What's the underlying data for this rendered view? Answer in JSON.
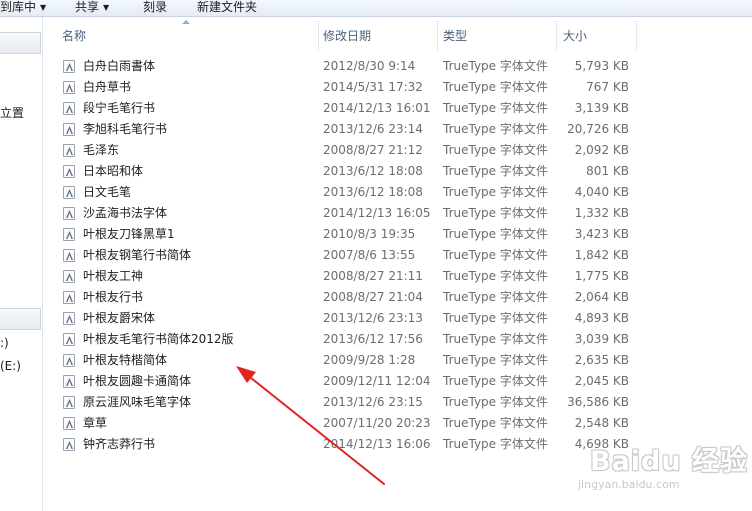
{
  "toolbar": {
    "library_label": "到库中",
    "share_label": "共享",
    "burn_label": "刻录",
    "new_folder_label": "新建文件夹"
  },
  "nav": {
    "location_fragment": "立置",
    "drive_c_fragment": ":)",
    "drive_e_fragment": "(E:)"
  },
  "columns": {
    "name": "名称",
    "date": "修改日期",
    "type": "类型",
    "size": "大小"
  },
  "files": [
    {
      "name": "白舟白雨書体",
      "date": "2012/8/30 9:14",
      "type": "TrueType 字体文件",
      "size": "5,793 KB"
    },
    {
      "name": "白舟草书",
      "date": "2014/5/31 17:32",
      "type": "TrueType 字体文件",
      "size": "767 KB"
    },
    {
      "name": "段宁毛笔行书",
      "date": "2014/12/13 16:01",
      "type": "TrueType 字体文件",
      "size": "3,139 KB"
    },
    {
      "name": "李旭科毛笔行书",
      "date": "2013/12/6 23:14",
      "type": "TrueType 字体文件",
      "size": "20,726 KB"
    },
    {
      "name": "毛泽东",
      "date": "2008/8/27 21:12",
      "type": "TrueType 字体文件",
      "size": "2,092 KB"
    },
    {
      "name": "日本昭和体",
      "date": "2013/6/12 18:08",
      "type": "TrueType 字体文件",
      "size": "801 KB"
    },
    {
      "name": "日文毛笔",
      "date": "2013/6/12 18:08",
      "type": "TrueType 字体文件",
      "size": "4,040 KB"
    },
    {
      "name": "沙孟海书法字体",
      "date": "2014/12/13 16:05",
      "type": "TrueType 字体文件",
      "size": "1,332 KB"
    },
    {
      "name": "叶根友刀锋黑草1",
      "date": "2010/8/3 19:35",
      "type": "TrueType 字体文件",
      "size": "3,423 KB"
    },
    {
      "name": "叶根友钢笔行书简体",
      "date": "2007/8/6 13:55",
      "type": "TrueType 字体文件",
      "size": "1,842 KB"
    },
    {
      "name": "叶根友工神",
      "date": "2008/8/27 21:11",
      "type": "TrueType 字体文件",
      "size": "1,775 KB"
    },
    {
      "name": "叶根友行书",
      "date": "2008/8/27 21:04",
      "type": "TrueType 字体文件",
      "size": "2,064 KB"
    },
    {
      "name": "叶根友爵宋体",
      "date": "2013/12/6 23:13",
      "type": "TrueType 字体文件",
      "size": "4,893 KB"
    },
    {
      "name": "叶根友毛笔行书简体2012版",
      "date": "2013/6/12 17:56",
      "type": "TrueType 字体文件",
      "size": "3,039 KB"
    },
    {
      "name": "叶根友特楷简体",
      "date": "2009/9/28 1:28",
      "type": "TrueType 字体文件",
      "size": "2,635 KB"
    },
    {
      "name": "叶根友圆趣卡通简体",
      "date": "2009/12/11 12:04",
      "type": "TrueType 字体文件",
      "size": "2,045 KB"
    },
    {
      "name": "原云涯风味毛笔字体",
      "date": "2013/12/6 23:15",
      "type": "TrueType 字体文件",
      "size": "36,586 KB"
    },
    {
      "name": "章草",
      "date": "2007/11/20 20:23",
      "type": "TrueType 字体文件",
      "size": "2,548 KB"
    },
    {
      "name": "钟齐志莽行书",
      "date": "2014/12/13 16:06",
      "type": "TrueType 字体文件",
      "size": "4,698 KB"
    }
  ],
  "watermark": {
    "main": "Baidu 经验",
    "sub": "jingyan.baidu.com"
  },
  "annotation_color": "#e52222"
}
